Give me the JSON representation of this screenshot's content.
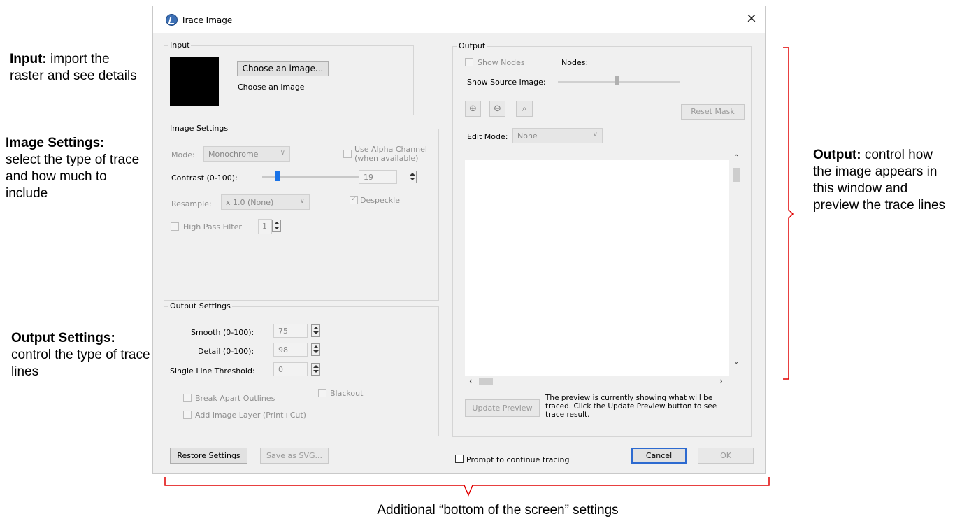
{
  "annotations": {
    "input": {
      "bold": "Input:",
      "rest": " import the raster and see details"
    },
    "image_settings": {
      "bold": "Image Settings:",
      "rest": "select the type of trace and how much to include"
    },
    "output_settings": {
      "bold": "Output Settings:",
      "rest": "control the type of trace lines"
    },
    "output": {
      "bold": "Output:",
      "rest": " control how the image appears in this window and preview the trace lines"
    },
    "bottom": "Additional “bottom of the screen” settings"
  },
  "dialog": {
    "title": "Trace Image",
    "close_glyph": "×"
  },
  "input": {
    "legend": "Input",
    "choose_button": "Choose an image...",
    "status": "Choose an image"
  },
  "image_settings": {
    "legend": "Image Settings",
    "mode_label": "Mode:",
    "mode_value": "Monochrome",
    "alpha_label_1": "Use Alpha Channel",
    "alpha_label_2": "(when available)",
    "contrast_label": "Contrast (0-100):",
    "contrast_value": "19",
    "resample_label": "Resample:",
    "resample_value": "x 1.0 (None)",
    "despeckle_label": "Despeckle",
    "high_pass_label": "High Pass Filter",
    "high_pass_value": "1"
  },
  "output_settings": {
    "legend": "Output Settings",
    "smooth_label": "Smooth (0-100):",
    "smooth_value": "75",
    "detail_label": "Detail (0-100):",
    "detail_value": "98",
    "single_line_label": "Single Line Threshold:",
    "single_line_value": "0",
    "break_apart_label": "Break Apart Outlines",
    "blackout_label": "Blackout",
    "add_layer_label": "Add Image Layer (Print+Cut)"
  },
  "output": {
    "legend": "Output",
    "show_nodes_label": "Show Nodes",
    "nodes_label": "Nodes:",
    "show_source_label": "Show Source Image:",
    "reset_mask": "Reset Mask",
    "edit_mode_label": "Edit Mode:",
    "edit_mode_value": "None",
    "update_preview": "Update Preview",
    "preview_note": "The preview is currently showing what will be traced. Click the Update Preview button to see trace result."
  },
  "footer": {
    "restore": "Restore Settings",
    "save_svg": "Save as SVG...",
    "prompt_label": "Prompt to continue tracing",
    "cancel": "Cancel",
    "ok": "OK"
  }
}
